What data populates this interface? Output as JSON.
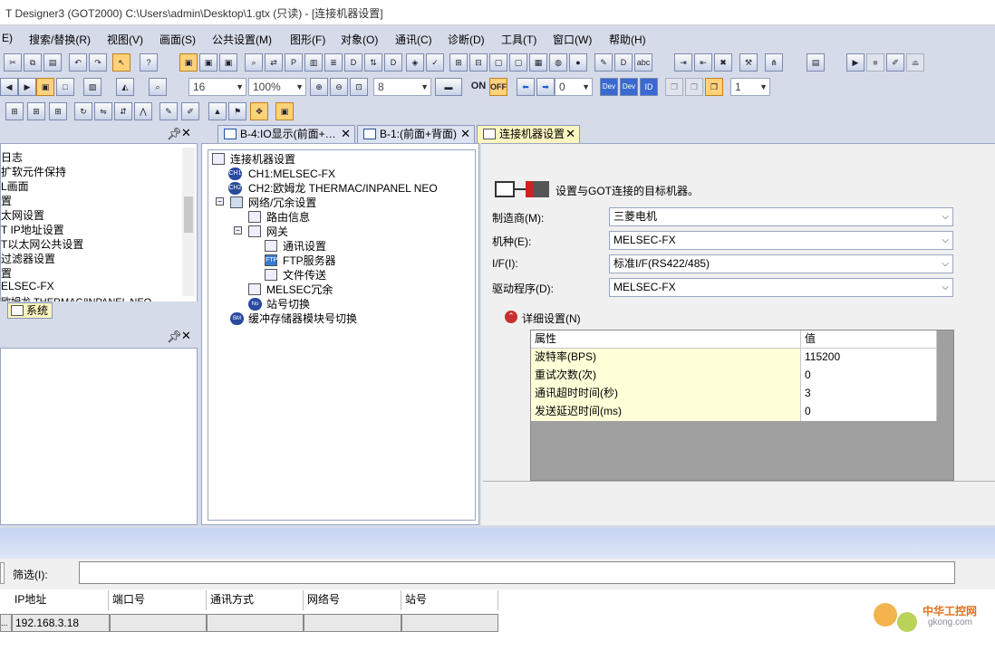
{
  "window": {
    "title": "T Designer3 (GOT2000) C:\\Users\\admin\\Desktop\\1.gtx (只读) - [连接机器设置]"
  },
  "menu": [
    "E)",
    "搜索/替换(R)",
    "视图(V)",
    "画面(S)",
    "公共设置(M)",
    "图形(F)",
    "对象(O)",
    "通讯(C)",
    "诊断(D)",
    "工具(T)",
    "窗口(W)",
    "帮助(H)"
  ],
  "toolbar": {
    "font_size": "16",
    "zoom": "100%",
    "grid": "8",
    "on_label": "ON",
    "off_label": "OFF",
    "station": "0",
    "dev1": "Dev",
    "dev2": "Dev",
    "id_label": "ID",
    "layer": "1"
  },
  "left_pane": {
    "items": [
      "日志",
      "扩软元件保持",
      "L画面",
      "置",
      "太网设置",
      "T IP地址设置",
      "T以太网公共设置",
      "过滤器设置",
      "置",
      "ELSEC-FX",
      "欧姆龙 THERMAC/INPANEL NEO"
    ],
    "tab_label": "系统"
  },
  "tabs": [
    {
      "label": "B-4:IO显示(前面+…",
      "close": "✕"
    },
    {
      "label": "B-1:(前面+背面)",
      "close": "✕"
    },
    {
      "label": "连接机器设置",
      "close": "✕"
    }
  ],
  "tree": {
    "root": "连接机器设置",
    "ch1": "CH1:MELSEC-FX",
    "ch2": "CH2:欧姆龙 THERMAC/INPANEL NEO",
    "network": "网络/冗余设置",
    "route": "路由信息",
    "gateway": "网关",
    "comm": "通讯设置",
    "ftp": "FTP服务器",
    "file": "文件传送",
    "melsec": "MELSEC冗余",
    "station": "站号切换",
    "buffer": "缓冲存储器模块号切换"
  },
  "settings": {
    "header": "设置与GOT连接的目标机器。",
    "maker_label": "制造商(M):",
    "maker": "三菱电机",
    "model_label": "机种(E):",
    "model": "MELSEC-FX",
    "if_label": "I/F(I):",
    "if": "标准I/F(RS422/485)",
    "driver_label": "驱动程序(D):",
    "driver": "MELSEC-FX",
    "detail": "详细设置(N)"
  },
  "grid": {
    "col_attr": "属性",
    "col_val": "值",
    "rows": [
      {
        "k": "波特率(BPS)",
        "v": "115200"
      },
      {
        "k": "重试次数(次)",
        "v": "0"
      },
      {
        "k": "通讯超时时间(秒)",
        "v": "3"
      },
      {
        "k": "发送延迟时间(ms)",
        "v": "0"
      }
    ]
  },
  "bottom": {
    "filter_label": "筛选(I):",
    "cols": [
      "IP地址",
      "端口号",
      "通讯方式",
      "网络号",
      "站号"
    ],
    "row_prefix": "...",
    "ip": "192.168.3.18"
  },
  "watermark": {
    "cn": "中华工控网",
    "url": "gkong.com"
  }
}
